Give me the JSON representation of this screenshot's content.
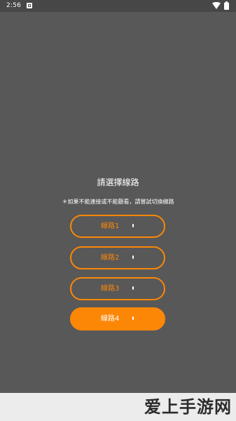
{
  "status_bar": {
    "time": "2:56",
    "icons": [
      "app-notification-icon",
      "wifi-icon",
      "battery-icon"
    ]
  },
  "title": "請選擇線路",
  "hint": "＊如果不能連接或不能觀看，請嘗試切換線路",
  "routes": [
    {
      "label": "線路1",
      "selected": false
    },
    {
      "label": "線路2",
      "selected": false
    },
    {
      "label": "線路3",
      "selected": false
    },
    {
      "label": "線路4",
      "selected": true
    }
  ],
  "watermark": "爱上手游网",
  "colors": {
    "background": "#585858",
    "status_bar": "#474747",
    "accent": "#fc8707",
    "text": "#ffffff",
    "bottom_band": "#ececec",
    "watermark_text": "#2c2c2c"
  }
}
